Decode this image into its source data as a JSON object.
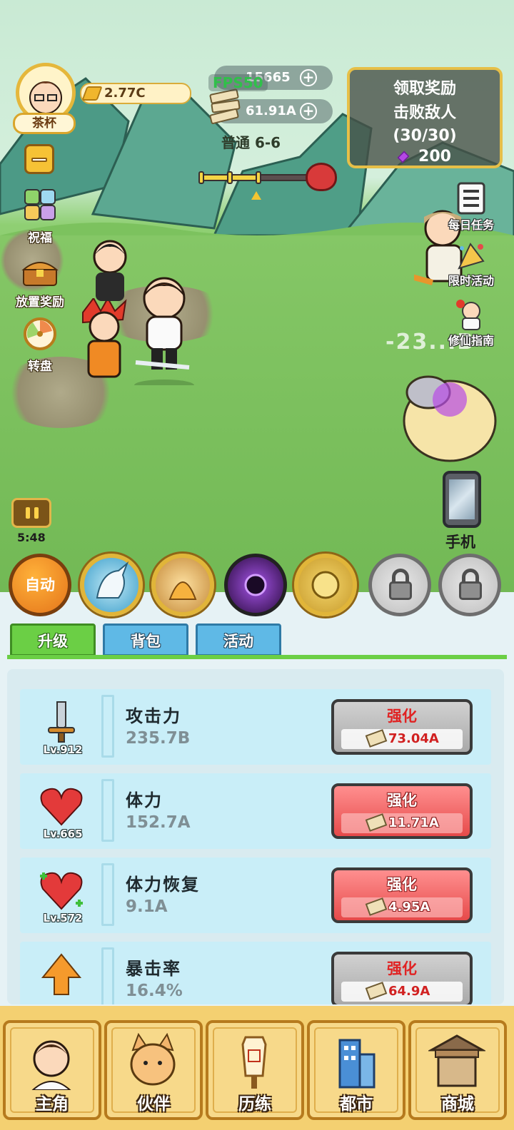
{
  "player": {
    "name": "茶杯",
    "gold": "2.77C"
  },
  "resources": {
    "gems": "15665",
    "cash": "61.91A",
    "fps": "FPS50"
  },
  "stage": {
    "label": "普通 6-6",
    "progress": 0.5
  },
  "reward_panel": {
    "title": "领取奖励",
    "task": "击败敌人",
    "progress": "(30/30)",
    "amount": "200"
  },
  "left_menu": [
    {
      "label": "祝福",
      "icon": "blessing-icon"
    },
    {
      "label": "放置奖励",
      "icon": "treasure-chest-icon"
    },
    {
      "label": "转盘",
      "icon": "wheel-icon"
    }
  ],
  "right_menu": [
    {
      "label": "每日任务",
      "icon": "checklist-icon"
    },
    {
      "label": "限时活动",
      "icon": "party-icon"
    },
    {
      "label": "修仙指南",
      "icon": "guide-icon"
    }
  ],
  "phone_label": "手机",
  "timer": "5:48",
  "damage_text": "-23...B",
  "skills": {
    "auto_label": "自动",
    "slots": [
      "unicorn-skill",
      "fire-skill",
      "dark-vortex-skill",
      "lion-skill",
      "locked",
      "locked"
    ]
  },
  "tabs": [
    {
      "label": "升级",
      "active": true
    },
    {
      "label": "背包",
      "active": false
    },
    {
      "label": "活动",
      "active": false
    }
  ],
  "upgrade_button_label": "强化",
  "stats": [
    {
      "name": "攻击力",
      "value": "235.7B",
      "level": "Lv.912",
      "cost": "73.04A",
      "affordable": false,
      "icon": "sword-icon"
    },
    {
      "name": "体力",
      "value": "152.7A",
      "level": "Lv.665",
      "cost": "11.71A",
      "affordable": true,
      "icon": "heart-icon"
    },
    {
      "name": "体力恢复",
      "value": "9.1A",
      "level": "Lv.572",
      "cost": "4.95A",
      "affordable": true,
      "icon": "heart-regen-icon"
    },
    {
      "name": "暴击率",
      "value": "16.4%",
      "level": "",
      "cost": "64.9A",
      "affordable": false,
      "icon": "crit-arrow-icon"
    }
  ],
  "nav": [
    {
      "label": "主角",
      "icon": "hero-icon"
    },
    {
      "label": "伙伴",
      "icon": "cat-icon"
    },
    {
      "label": "历练",
      "icon": "signpost-icon"
    },
    {
      "label": "都市",
      "icon": "city-icon"
    },
    {
      "label": "商城",
      "icon": "shop-stall-icon"
    }
  ],
  "colors": {
    "accent_green": "#6bcf45",
    "tab_blue": "#5fb9e6",
    "upgrade_red": "#e64a4a",
    "gold_border": "#e1b539"
  }
}
